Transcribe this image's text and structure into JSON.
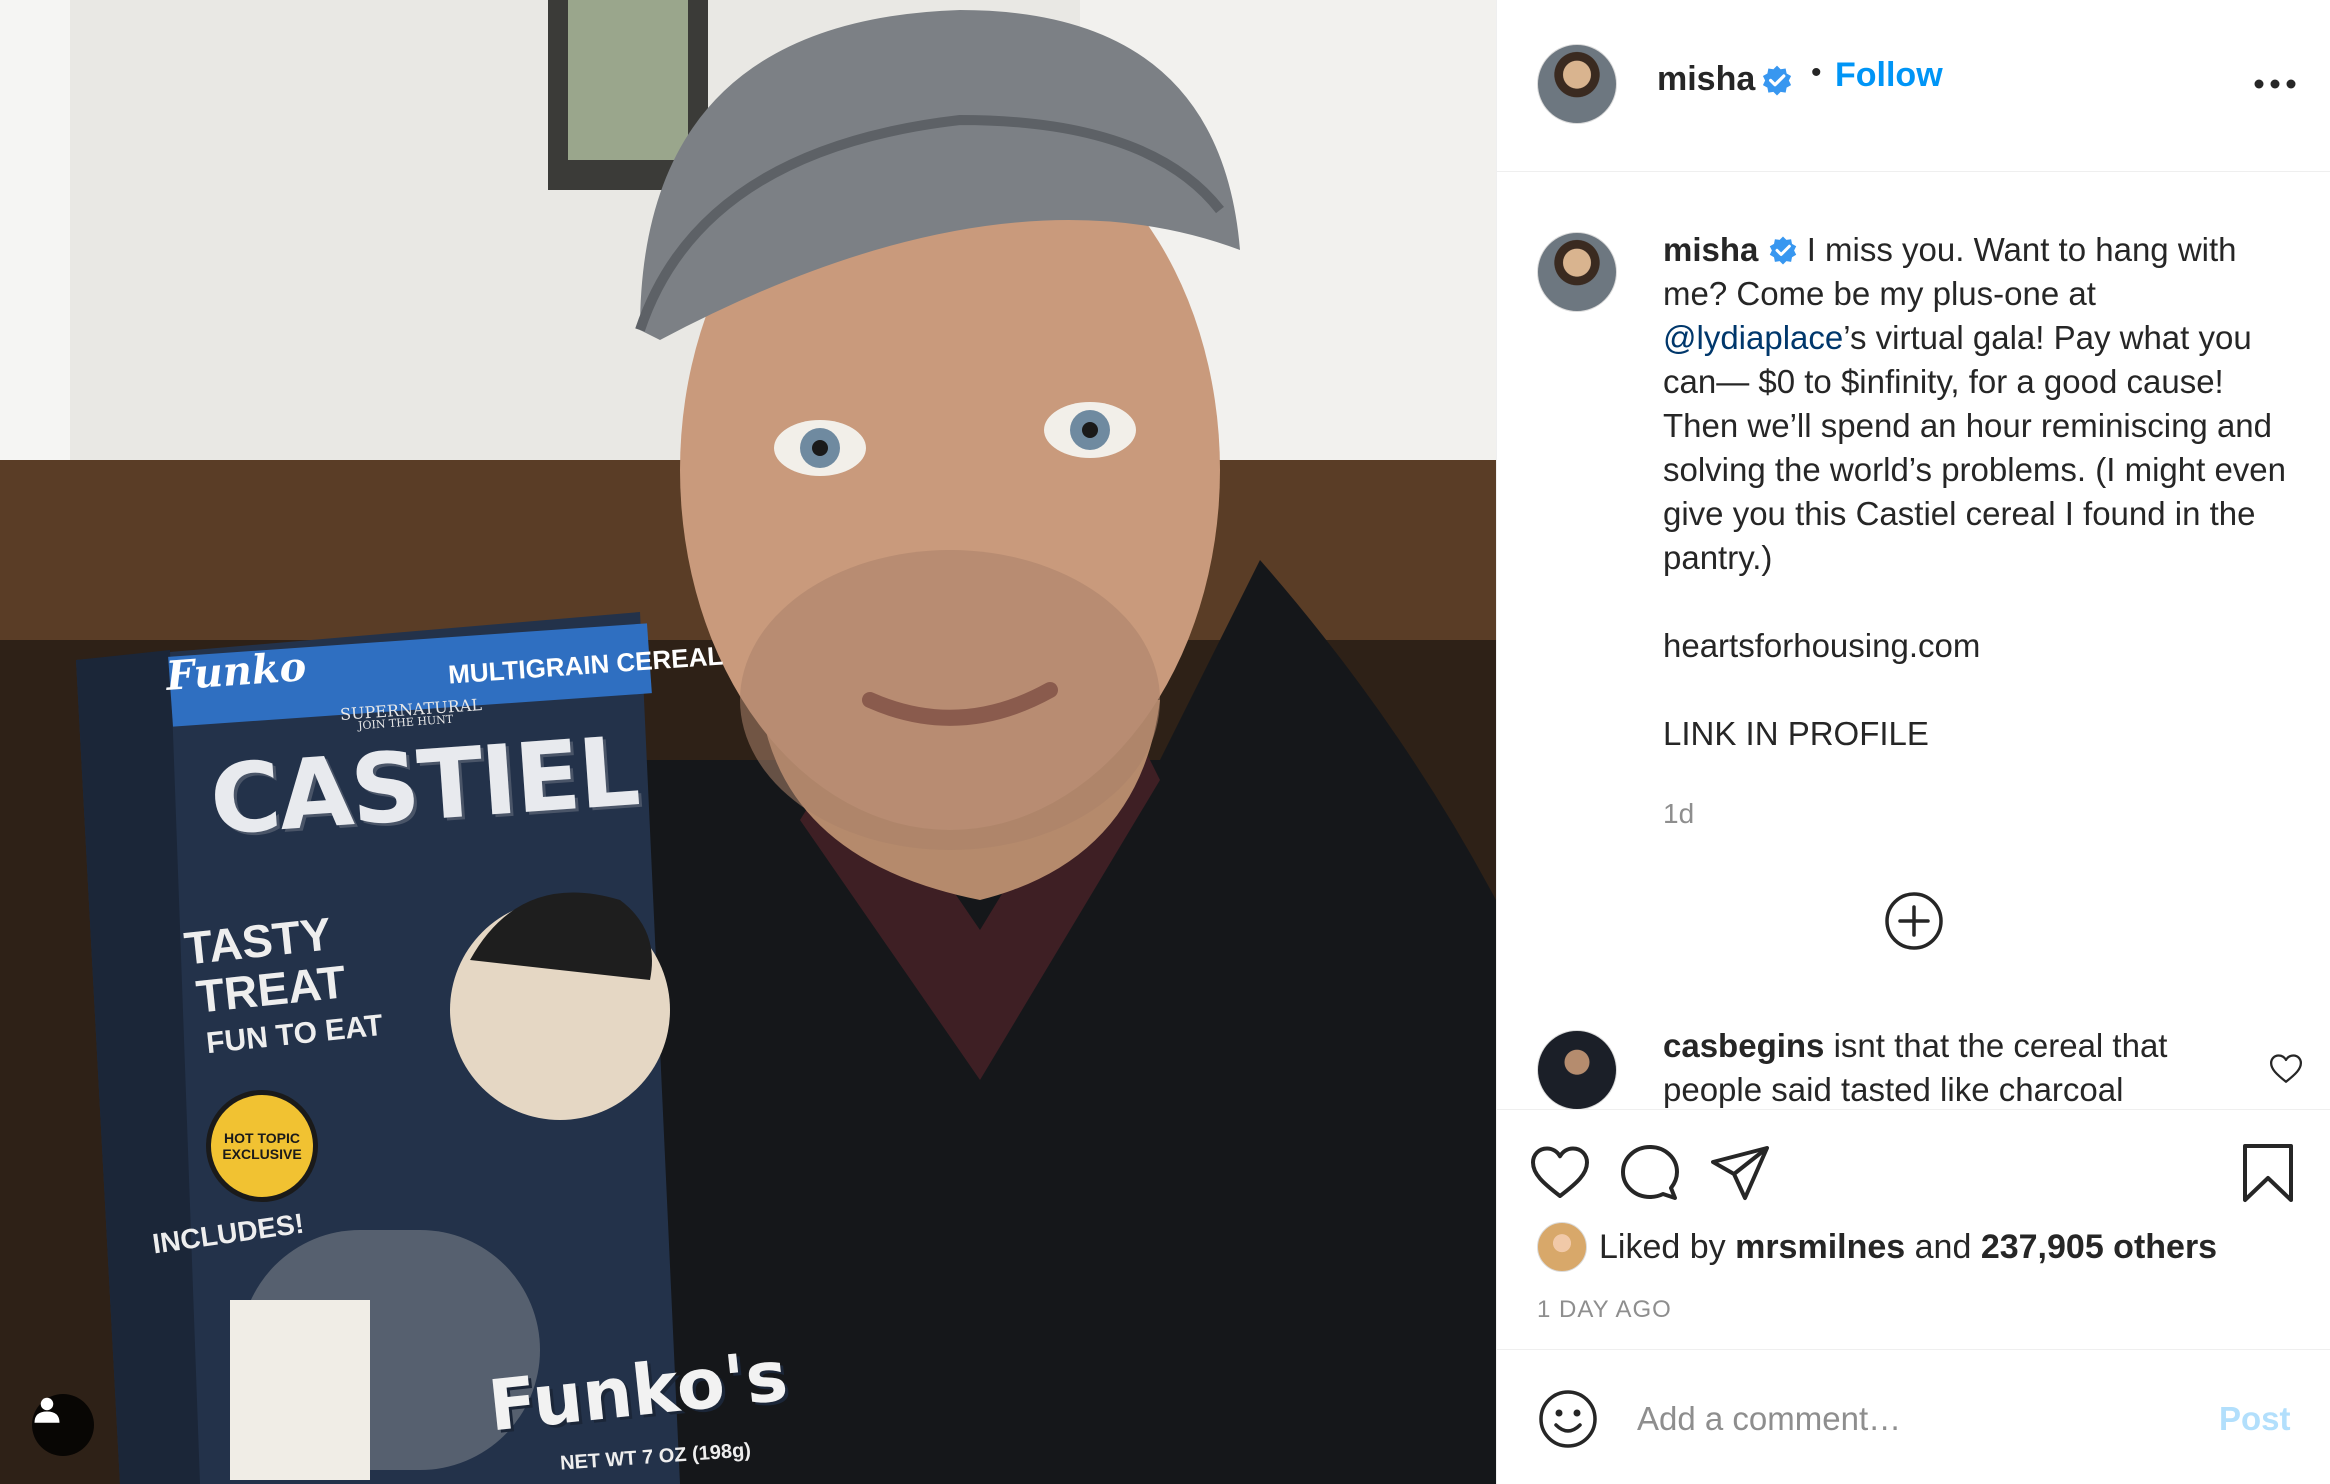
{
  "post": {
    "photo_alt": "Selfie holding a Castiel Funko cereal box",
    "cereal_box": {
      "brand": "Funko",
      "type": "MULTIGRAIN CEREAL",
      "series": "SUPERNATURAL",
      "tagline": "JOIN THE HUNT",
      "name": "CASTIEL",
      "treat_1": "TASTY",
      "treat_2": "TREAT",
      "treat_3": "FUN TO EAT",
      "exclusive": "HOT TOPIC EXCLUSIVE",
      "includes": "INCLUDES!",
      "product": "Funko's",
      "weight": "NET WT 7 OZ (198g)"
    }
  },
  "header": {
    "username": "misha",
    "separator": "•",
    "follow_label": "Follow",
    "more_icon": "more-horizontal-icon"
  },
  "caption": {
    "username": "misha",
    "text_1": "I miss you. Want to hang with me? Come be my plus-one at ",
    "mention": "@lydiaplace",
    "text_2": "’s virtual gala! Pay what you can— $0 to $infinity, for a good cause! Then we’ll spend an hour reminiscing and solving the world’s problems. (I might even give you this Castiel cereal I found in the pantry.)\n\nheartsforhousing.com\n\nLINK IN PROFILE",
    "time": "1d"
  },
  "comments": [
    {
      "username": "casbegins",
      "text": "isnt that the cereal that people said tasted like charcoal"
    }
  ],
  "actions": {
    "liked_by_prefix": "Liked by",
    "liked_by_user": "mrsmilnes",
    "liked_by_and": "and",
    "likes_count": "237,905 others",
    "timestamp": "1 day ago"
  },
  "add_comment": {
    "placeholder": "Add a comment…",
    "post_label": "Post"
  },
  "colors": {
    "link_blue": "#0095f6",
    "mention_blue": "#00376b",
    "verified_blue": "#3897f0",
    "post_disabled": "#b2dffc",
    "muted": "#8e8e8e"
  }
}
